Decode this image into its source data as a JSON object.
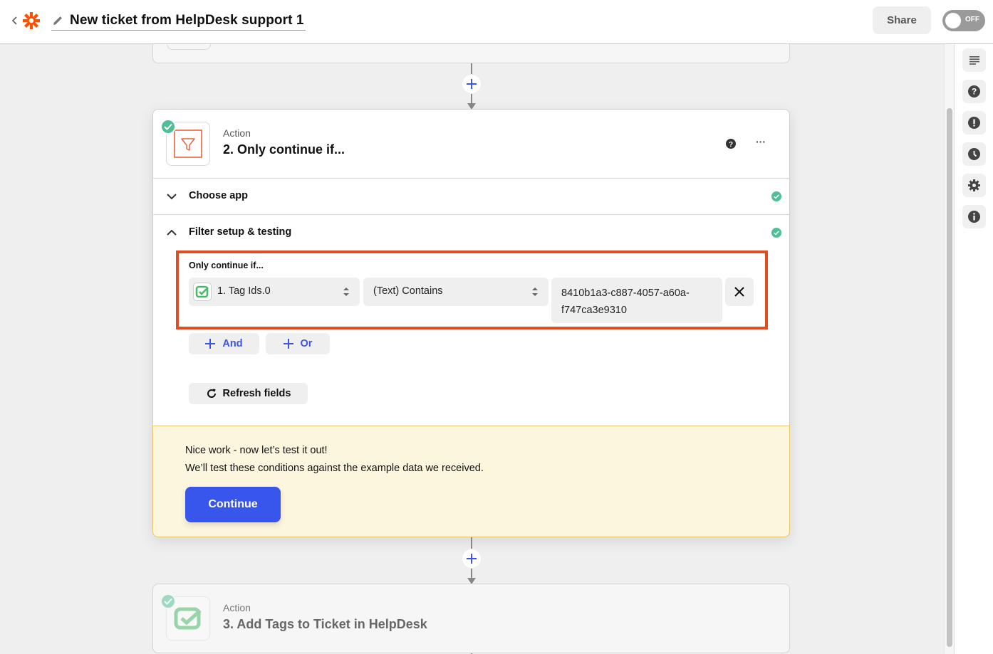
{
  "header": {
    "title": "New ticket from HelpDesk support 1",
    "share_label": "Share",
    "toggle_label": "OFF",
    "toggle_state": "off",
    "brand_color": "#ff4f00"
  },
  "right_rail": {
    "buttons": [
      {
        "icon": "outline-icon",
        "label": "Outline"
      },
      {
        "icon": "help-icon",
        "label": "Help"
      },
      {
        "icon": "alert-icon",
        "label": "Alerts"
      },
      {
        "icon": "history-icon",
        "label": "Version history"
      },
      {
        "icon": "settings-icon",
        "label": "Settings"
      },
      {
        "icon": "info-icon",
        "label": "Details"
      }
    ]
  },
  "steps": {
    "current": {
      "kind": "Action",
      "title": "2. Only continue if...",
      "app_icon": "filter-icon",
      "status": "complete",
      "sections": [
        {
          "label": "Choose app",
          "expanded": false,
          "status": "complete"
        },
        {
          "label": "Filter setup & testing",
          "expanded": true,
          "status": "complete"
        }
      ],
      "filter": {
        "label": "Only continue if...",
        "rules": [
          {
            "field": "1. Tag Ids.0",
            "field_app_icon": "helpdesk-icon",
            "operator": "(Text) Contains",
            "value": "8410b1a3-c887-4057-a60a-f747ca3e9310",
            "value_line1": "8410b1a3-c887-4057-a60a-",
            "value_line2": "f747ca3e9310"
          }
        ],
        "and_label": "And",
        "or_label": "Or",
        "refresh_label": "Refresh fields",
        "highlight_color": "#e14d22"
      },
      "test": {
        "line1": "Nice work - now let’s test it out!",
        "line2": "We’ll test these conditions against the example data we received.",
        "continue_label": "Continue",
        "button_color": "#3856eb"
      }
    },
    "next": {
      "kind": "Action",
      "title": "3. Add Tags to Ticket in HelpDesk",
      "app_icon": "helpdesk-icon",
      "status": "complete"
    }
  }
}
